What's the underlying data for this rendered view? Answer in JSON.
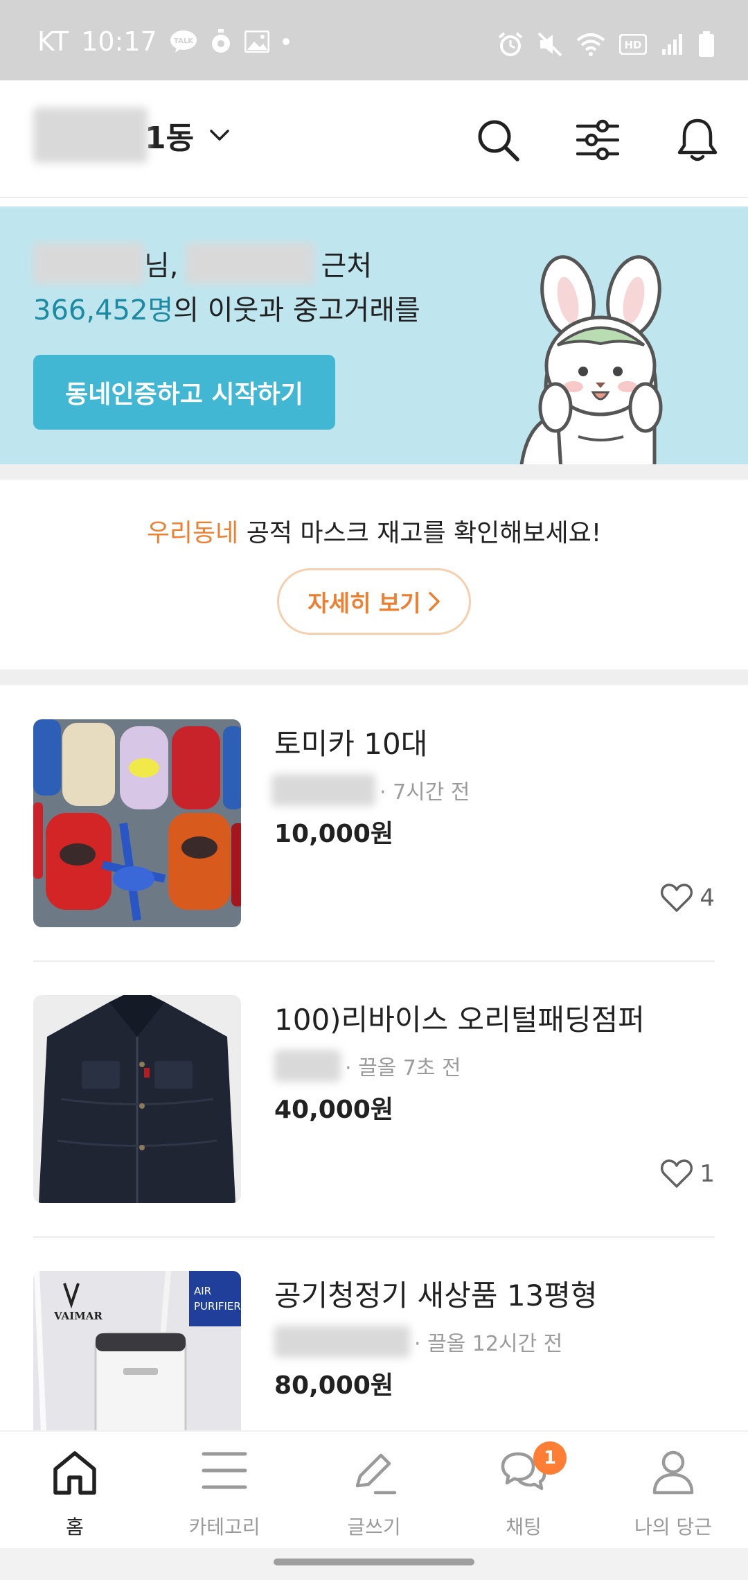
{
  "status_bar": {
    "carrier": "KT",
    "time": "10:17",
    "talk_badge": "TALK",
    "hd_label": "HD"
  },
  "header": {
    "location_suffix": "1동"
  },
  "banner": {
    "line1_mid": "님,",
    "line1_end": "근처",
    "neighbor_count": "366,452명",
    "line2_rest": "의 이웃과 중고거래를",
    "cta_label": "동네인증하고 시작하기"
  },
  "mask_notice": {
    "highlight": "우리동네",
    "text": " 공적 마스크 재고를 확인해보세요!",
    "button_label": "자세히 보기"
  },
  "items": [
    {
      "title": "토미카 10대",
      "meta": "· 7시간 전",
      "price": "10,000원",
      "likes": "4"
    },
    {
      "title": "100)리바이스 오리털패딩점퍼",
      "meta": "· 끌올 7초 전",
      "price": "40,000원",
      "likes": "1"
    },
    {
      "title": "공기청정기 새상품 13평형",
      "meta": "· 끌올 12시간 전",
      "price": "80,000원"
    }
  ],
  "item3_thumb": {
    "brand": "VAIMAR",
    "box_text_1": "AIR",
    "box_text_2": "PURIFIER"
  },
  "bottom_nav": {
    "home": "홈",
    "category": "카테고리",
    "write": "글쓰기",
    "chat": "채팅",
    "my": "나의 당근",
    "chat_badge": "1"
  },
  "colors": {
    "accent_orange": "#ed7f31",
    "banner_bg": "#bfe6ef",
    "cta_teal": "#41b7d3",
    "badge": "#ff7e36"
  }
}
